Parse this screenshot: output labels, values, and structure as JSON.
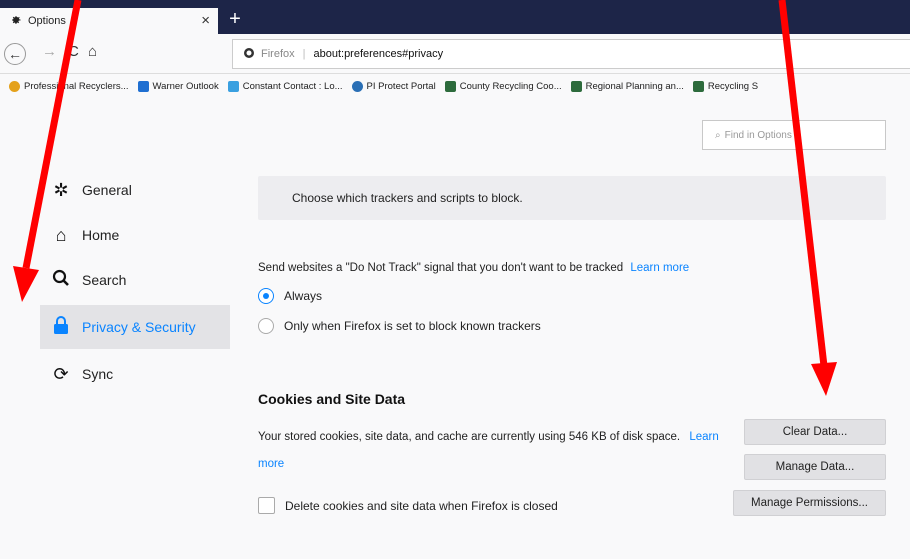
{
  "tab": {
    "title": "Options",
    "close": "×",
    "new_tab": "+"
  },
  "nav": {
    "back": "←",
    "forward": "→",
    "reload": "C",
    "home": "⌂",
    "url_brand": "Firefox",
    "url": "about:preferences#privacy"
  },
  "bookmarks": [
    {
      "label": "Professional Recyclers...",
      "color": "#e4a11b"
    },
    {
      "label": "Warner Outlook",
      "color": "#1f6fd1"
    },
    {
      "label": "Constant Contact : Lo...",
      "color": "#3aa0e0"
    },
    {
      "label": "PI Protect Portal",
      "color": "#2a6fb5"
    },
    {
      "label": "County Recycling Coo...",
      "color": "#2d6b3c"
    },
    {
      "label": "Regional Planning an...",
      "color": "#2d6b3c"
    },
    {
      "label": "Recycling S",
      "color": "#2d6b3c"
    }
  ],
  "search": {
    "placeholder": "Find in Options"
  },
  "sidebar": {
    "items": [
      {
        "label": "General",
        "icon": "gear-icon"
      },
      {
        "label": "Home",
        "icon": "home-icon"
      },
      {
        "label": "Search",
        "icon": "search-icon"
      },
      {
        "label": "Privacy & Security",
        "icon": "lock-icon",
        "selected": true
      },
      {
        "label": "Sync",
        "icon": "sync-icon"
      }
    ]
  },
  "privacy": {
    "tracker_text": "Choose which trackers and scripts to block.",
    "dnt_label": "Send websites a \"Do Not Track\" signal that you don't want to be tracked",
    "dnt_learn_more": "Learn more",
    "dnt_options": [
      {
        "label": "Always",
        "checked": true
      },
      {
        "label": "Only when Firefox is set to block known trackers",
        "checked": false
      }
    ]
  },
  "cookies": {
    "title": "Cookies and Site Data",
    "description": "Your stored cookies, site data, and cache are currently using 546 KB of disk space.",
    "learn_more": "Learn more",
    "clear_button": "Clear Data...",
    "manage_button": "Manage Data...",
    "permissions_button": "Manage Permissions...",
    "delete_checkbox": "Delete cookies and site data when Firefox is closed"
  },
  "colors": {
    "accent": "#0a84ff",
    "annotation": "#ff0000",
    "tabstrip": "#1d2548"
  }
}
